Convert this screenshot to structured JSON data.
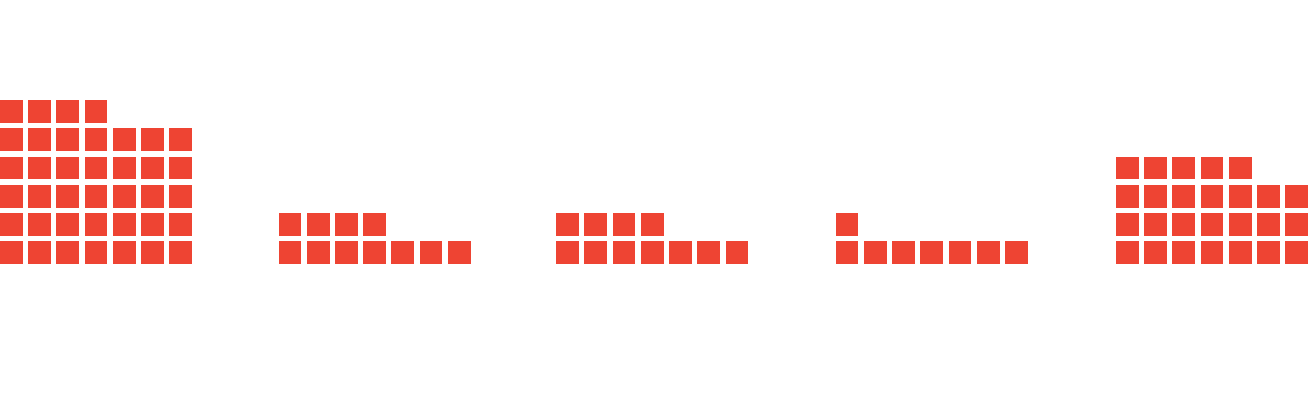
{
  "chart_data": {
    "type": "bar",
    "subtype": "waffle-column",
    "units_per_row": 7,
    "values": [
      39,
      11,
      11,
      8,
      26
    ],
    "color": "#EE4433",
    "legend": "none",
    "grid": false
  }
}
